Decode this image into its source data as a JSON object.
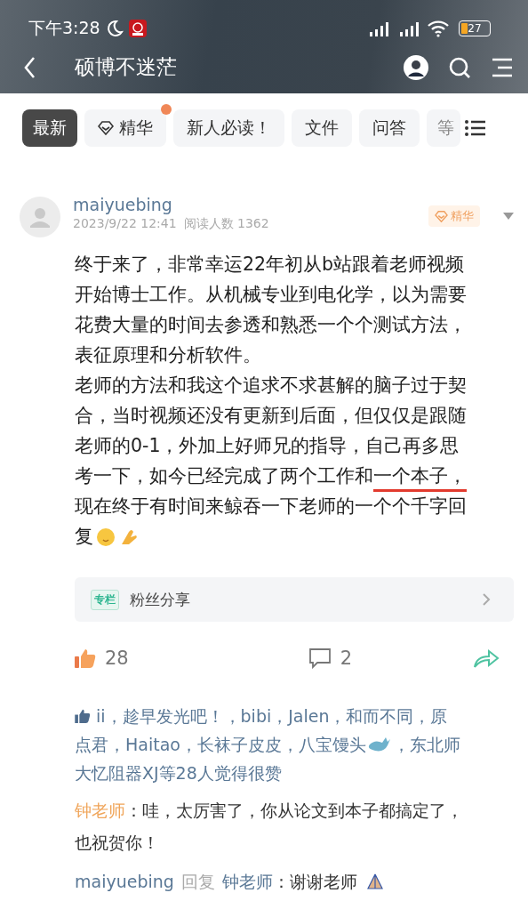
{
  "status_bar": {
    "time": "下午3:28",
    "battery": "27"
  },
  "header": {
    "title": "硕博不迷茫"
  },
  "tabs": [
    {
      "label": "最新",
      "selected": true,
      "kind": "plain",
      "dot": false,
      "faded": false
    },
    {
      "label": "精华",
      "selected": false,
      "kind": "icon",
      "dot": true,
      "faded": false
    },
    {
      "label": "新人必读！",
      "selected": false,
      "kind": "plain",
      "dot": false,
      "faded": false
    },
    {
      "label": "文件",
      "selected": false,
      "kind": "plain",
      "dot": false,
      "faded": false
    },
    {
      "label": "问答",
      "selected": false,
      "kind": "plain",
      "dot": false,
      "faded": false
    },
    {
      "label": "等",
      "selected": false,
      "kind": "plain",
      "dot": false,
      "faded": true
    }
  ],
  "post": {
    "author": "maiyuebing",
    "date": "2023/9/22 12:41",
    "reads": "阅读人数 1362",
    "badge": "精华",
    "lines": [
      {
        "segments": [
          {
            "text": "终于来了，非常幸运22年初从b站跟着老师视频",
            "underlined": false
          }
        ],
        "emoji": false
      },
      {
        "segments": [
          {
            "text": "开始博士工作。从机械专业到电化学，以为需要",
            "underlined": false
          }
        ],
        "emoji": false
      },
      {
        "segments": [
          {
            "text": "花费大量的时间去参透和熟悉一个个测试方法，",
            "underlined": false
          }
        ],
        "emoji": false
      },
      {
        "segments": [
          {
            "text": "表征原理和分析软件。",
            "underlined": false
          }
        ],
        "emoji": false
      },
      {
        "segments": [
          {
            "text": "老师的方法和我这个追求不求甚解的脑子过于契",
            "underlined": false
          }
        ],
        "emoji": false
      },
      {
        "segments": [
          {
            "text": "合，当时视频还没有更新到后面，但仅仅是跟随",
            "underlined": false
          }
        ],
        "emoji": false
      },
      {
        "segments": [
          {
            "text": "老师的0-1，外加上好师兄的指导，自己再多思",
            "underlined": false
          }
        ],
        "emoji": false
      },
      {
        "segments": [
          {
            "text": "考一下，如今已经完成了两个工作和",
            "underlined": false
          },
          {
            "text": "一个本子，",
            "underlined": true
          }
        ],
        "emoji": false
      },
      {
        "segments": [
          {
            "text": "现在终于有时间来鲸吞一下老师的一个个千字回",
            "underlined": false
          }
        ],
        "emoji": false
      },
      {
        "segments": [
          {
            "text": "复",
            "underlined": false
          }
        ],
        "emoji": true
      }
    ],
    "column": {
      "tag": "专栏",
      "title": "粉丝分享"
    },
    "likes": "28",
    "comments": "2",
    "liked_by": [
      {
        "items": [
          {
            "kind": "thumb"
          },
          {
            "kind": "text",
            "text": "ii，趁早发光吧！，bibi，Jalen，和而不同，原"
          }
        ]
      },
      {
        "items": [
          {
            "kind": "text",
            "text": "点君，Haitao，长袜子皮皮，八宝馒头"
          },
          {
            "kind": "whale"
          },
          {
            "kind": "text",
            "text": "，东北师"
          }
        ]
      },
      {
        "items": [
          {
            "kind": "text",
            "text": "大忆阻器XJ等28人觉得很赞"
          }
        ]
      }
    ],
    "comment": {
      "author": "钟老师",
      "lines": [
        "：哇，太厉害了，你从论文到本子都搞定了，",
        "也祝贺你！"
      ]
    },
    "reply": {
      "author": "maiyuebing",
      "verb": "回复",
      "target": "钟老师",
      "text": "：谢谢老师"
    }
  }
}
